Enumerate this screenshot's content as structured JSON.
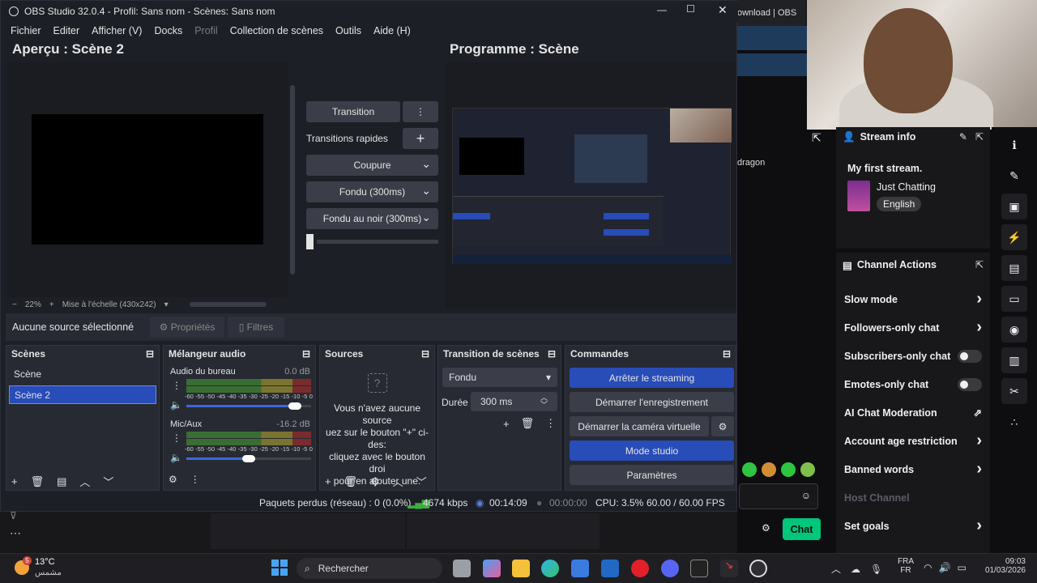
{
  "browser": {
    "tab_title": "ownload | OBS",
    "side_text": "dragon"
  },
  "twitch": {
    "stream_info": {
      "header": "Stream info",
      "title": "My first stream.",
      "category": "Just Chatting",
      "language": "English"
    },
    "channel_actions": {
      "header": "Channel Actions",
      "items": [
        {
          "label": "Slow mode",
          "control": "chevron"
        },
        {
          "label": "Followers-only chat",
          "control": "chevron"
        },
        {
          "label": "Subscribers-only chat",
          "control": "toggle"
        },
        {
          "label": "Emotes-only chat",
          "control": "toggle"
        },
        {
          "label": "AI Chat Moderation",
          "control": "external"
        },
        {
          "label": "Account age restriction",
          "control": "chevron"
        },
        {
          "label": "Banned words",
          "control": "chevron"
        },
        {
          "label": "Host Channel",
          "control": "none"
        },
        {
          "label": "Set goals",
          "control": "chevron"
        }
      ]
    },
    "chat_button": "Chat",
    "accent_color": "#00db84"
  },
  "obs": {
    "title": "OBS Studio 32.0.4 - Profil: Sans nom - Scènes: Sans nom",
    "menu": [
      "Fichier",
      "Editer",
      "Afficher (V)",
      "Docks",
      "Profil",
      "Collection de scènes",
      "Outils",
      "Aide (H)"
    ],
    "preview_title": "Aperçu : Scène 2",
    "program_title": "Programme : Scène",
    "zoom": "22%",
    "scale_label": "Mise à l'échelle (430x242)",
    "transition_button": "Transition",
    "quick_transitions_label": "Transitions rapides",
    "quick_items": [
      "Coupure",
      "Fondu (300ms)",
      "Fondu au noir (300ms)"
    ],
    "no_source": "Aucune source sélectionné",
    "properties_button": "Propriétés",
    "filters_button": "Filtres",
    "scenes": {
      "header": "Scènes",
      "items": [
        "Scène",
        "Scène 2"
      ]
    },
    "mixer": {
      "header": "Mélangeur audio",
      "channels": [
        {
          "name": "Audio du bureau",
          "db": "0.0 dB",
          "level": 0.92
        },
        {
          "name": "Mic/Aux",
          "db": "-16.2 dB",
          "level": 0.55
        }
      ],
      "ticks": [
        "-60",
        "-55",
        "-50",
        "-45",
        "-40",
        "-35",
        "-30",
        "-25",
        "-20",
        "-15",
        "-10",
        "-5",
        "0"
      ]
    },
    "sources": {
      "header": "Sources",
      "empty_text": "Vous n'avez aucune source\nuez sur le bouton \"+\" ci-des:\ncliquez avec le bouton droi\npour en ajouter une."
    },
    "transitions": {
      "header": "Transition de scènes",
      "selected": "Fondu",
      "duration_label": "Durée",
      "duration": "300 ms"
    },
    "controls": {
      "header": "Commandes",
      "stop_streaming": "Arrêter le streaming",
      "start_recording": "Démarrer l'enregistrement",
      "virtual_cam": "Démarrer la caméra virtuelle",
      "studio_mode": "Mode studio",
      "settings": "Paramètres"
    },
    "status": {
      "dropped": "Paquets perdus (réseau) : 0 (0.0%)",
      "bitrate": "4674 kbps",
      "stream_time": "00:14:09",
      "rec_time": "00:00:00",
      "cpu": "CPU: 3.5%",
      "fps": "60.00 / 60.00 FPS"
    }
  },
  "taskbar": {
    "weather_temp": "13°C",
    "weather_desc": "مشمس",
    "weather_badge": "5",
    "search": "Rechercher",
    "lang1": "FRA",
    "lang2": "FR",
    "time": "09:03",
    "date": "01/03/2026"
  }
}
